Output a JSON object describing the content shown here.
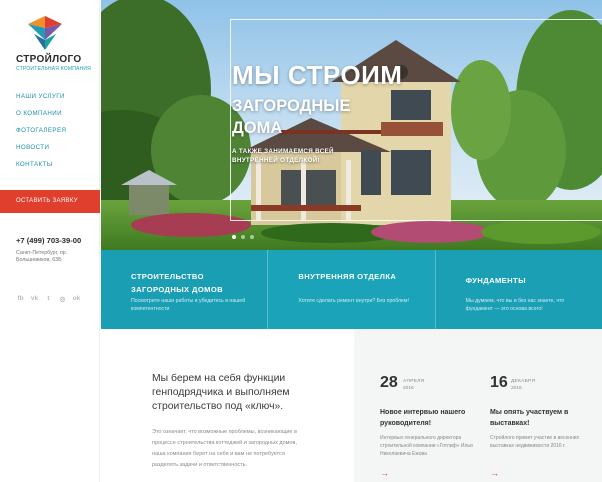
{
  "brand": {
    "name": "СТРОЙЛОГО",
    "tagline": "СТРОИТЕЛЬНАЯ КОМПАНИЯ"
  },
  "nav": {
    "items": [
      {
        "label": "НАШИ УСЛУГИ"
      },
      {
        "label": "О КОМПАНИИ"
      },
      {
        "label": "ФОТОГАЛЕРЕЯ"
      },
      {
        "label": "НОВОСТИ"
      },
      {
        "label": "КОНТАКТЫ"
      }
    ]
  },
  "cta": {
    "label": "ОСТАВИТЬ ЗАЯВКУ"
  },
  "contact": {
    "phone": "+7 (499) 703-39-00",
    "address": "Санкт-Петербург, пр. Большевиков, 63Б"
  },
  "social": [
    {
      "icon": "facebook-icon",
      "glyph": "fb"
    },
    {
      "icon": "vk-icon",
      "glyph": "vk"
    },
    {
      "icon": "twitter-icon",
      "glyph": "t"
    },
    {
      "icon": "instagram-icon",
      "glyph": "◎"
    },
    {
      "icon": "odnoklassniki-icon",
      "glyph": "ok"
    }
  ],
  "hero": {
    "title": "МЫ СТРОИМ",
    "subtitle": "ЗАГОРОДНЫЕ ДОМА",
    "note": "А ТАКЖЕ ЗАНИМАЕМСЯ ВСЕЙ ВНУТРЕННЕЙ ОТДЕЛКОЙ!",
    "slide_count": 3,
    "active_slide": 1
  },
  "services": [
    {
      "title": "СТРОИТЕЛЬСТВО ЗАГОРОДНЫХ ДОМОВ",
      "text": "Посмотрите наши работы и убедитесь в нашей компетентности",
      "color": "#1a9eb4"
    },
    {
      "title": "ВНУТРЕННЯЯ ОТДЕЛКА",
      "text": "Хотите сделать ремонт внутри? Без проблем!",
      "color": "#1ba3b9"
    },
    {
      "title": "ФУНДАМЕНТЫ",
      "text": "Мы думаем, что вы и без нас знаете, что фундамент — это основа всего!",
      "color": "#1b9fb5"
    }
  ],
  "about": {
    "lead": "Мы берем на себя функции генподрядчика и выполняем строительство под «ключ».",
    "body": "Это означает, что возможные проблемы, возникающие в процессе строительства коттеджей и загородных домов, наша компания берет на себя и вам не потребуется разделять задачи и ответственность."
  },
  "news": [
    {
      "day": "28",
      "month": "АПРЕЛЯ",
      "year": "2016",
      "title": "Новое интервью нашего руководителя!",
      "text": "Интервью генерального директора строительной компании «Готлиф» Ильи Николаевича Ежова"
    },
    {
      "day": "16",
      "month": "ДЕКАБРЯ",
      "year": "2016",
      "title": "Мы опять участвуем в выставках!",
      "text": "Стройлого примет участие в весенних выставках недвижимости 2016 г."
    }
  ],
  "colors": {
    "accent": "#e13f2e",
    "teal": "#1a9eb4",
    "nav_text": "#1f8fae"
  }
}
